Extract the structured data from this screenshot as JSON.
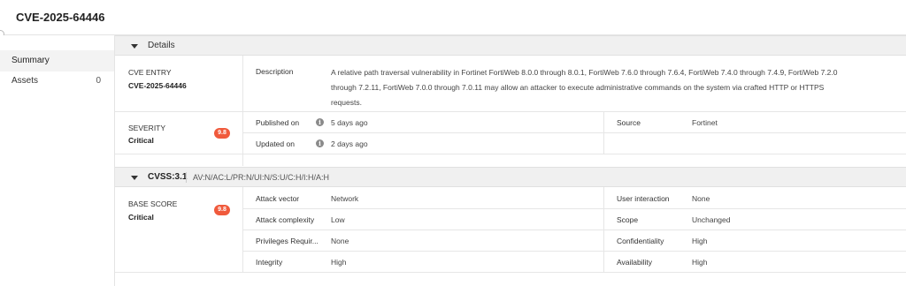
{
  "page": {
    "title": "CVE-2025-64446"
  },
  "sidebar": {
    "items": [
      {
        "label": "Summary",
        "count": "",
        "active": true
      },
      {
        "label": "Assets",
        "count": "0",
        "active": false
      }
    ]
  },
  "details": {
    "section_title": "Details",
    "cve_entry": {
      "label": "CVE ENTRY",
      "value": "CVE-2025-64446"
    },
    "description": {
      "label": "Description",
      "text": "A relative path traversal vulnerability in Fortinet FortiWeb 8.0.0 through 8.0.1, FortiWeb 7.6.0 through 7.6.4, FortiWeb 7.4.0 through 7.4.9, FortiWeb 7.2.0 through 7.2.11, FortiWeb 7.0.0 through 7.0.11 may allow an attacker to execute administrative commands on the system via crafted HTTP or HTTPS requests."
    },
    "severity": {
      "label": "SEVERITY",
      "value": "Critical",
      "score": "9.8"
    },
    "published": {
      "label": "Published on",
      "value": "5 days ago"
    },
    "updated": {
      "label": "Updated on",
      "value": "2 days ago"
    },
    "source": {
      "label": "Source",
      "value": "Fortinet"
    }
  },
  "cvss": {
    "section_title": "CVSS:3.1",
    "vector": "AV:N/AC:L/PR:N/UI:N/S:U/C:H/I:H/A:H",
    "base_score": {
      "label": "BASE SCORE",
      "value": "Critical",
      "score": "9.8"
    },
    "metrics_left": [
      {
        "label": "Attack vector",
        "value": "Network"
      },
      {
        "label": "Attack complexity",
        "value": "Low"
      },
      {
        "label": "Privileges Requir...",
        "value": "None"
      },
      {
        "label": "Integrity",
        "value": "High"
      }
    ],
    "metrics_right": [
      {
        "label": "User interaction",
        "value": "None"
      },
      {
        "label": "Scope",
        "value": "Unchanged"
      },
      {
        "label": "Confidentiality",
        "value": "High"
      },
      {
        "label": "Availability",
        "value": "High"
      }
    ]
  },
  "colors": {
    "badge": "#f05a3c",
    "section_bg": "#f0f0f0"
  },
  "icons": {
    "info": "info-icon",
    "chevron": "chevron-down-icon"
  }
}
